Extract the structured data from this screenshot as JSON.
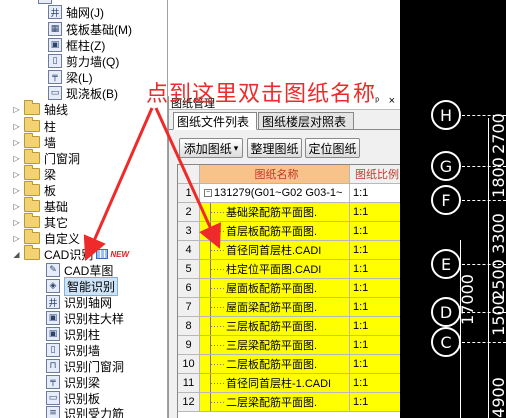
{
  "tree": {
    "items": [
      {
        "label": "轴网(J)",
        "icon": "axis-grid-icon",
        "glyph": "井"
      },
      {
        "label": "筏板基础(M)",
        "icon": "raft-foundation-icon",
        "glyph": "▦"
      },
      {
        "label": "框柱(Z)",
        "icon": "frame-column-icon",
        "glyph": "▣"
      },
      {
        "label": "剪力墙(Q)",
        "icon": "shear-wall-icon",
        "glyph": "▯"
      },
      {
        "label": "梁(L)",
        "icon": "beam-icon",
        "glyph": "╤"
      },
      {
        "label": "现浇板(B)",
        "icon": "slab-icon",
        "glyph": "▭"
      }
    ],
    "folders": [
      "轴线",
      "柱",
      "墙",
      "门窗洞",
      "梁",
      "板",
      "基础",
      "其它",
      "自定义"
    ],
    "cad_group": "CAD识别",
    "new_badge": "NEW",
    "cad_items": [
      {
        "label": "CAD草图",
        "icon": "cad-sketch-icon",
        "glyph": "✎"
      },
      {
        "label": "智能识别",
        "icon": "smart-recognition-icon",
        "glyph": "◈"
      },
      {
        "label": "识别轴网",
        "icon": "recognize-axis-icon",
        "glyph": "井"
      },
      {
        "label": "识别柱大样",
        "icon": "recognize-column-detail-icon",
        "glyph": "▣"
      },
      {
        "label": "识别柱",
        "icon": "recognize-column-icon",
        "glyph": "▣"
      },
      {
        "label": "识别墙",
        "icon": "recognize-wall-icon",
        "glyph": "▯"
      },
      {
        "label": "识别门窗洞",
        "icon": "recognize-door-window-icon",
        "glyph": "⊓"
      },
      {
        "label": "识别梁",
        "icon": "recognize-beam-icon",
        "glyph": "╤"
      },
      {
        "label": "识别板",
        "icon": "recognize-slab-icon",
        "glyph": "▭"
      },
      {
        "label": "识别受力筋",
        "icon": "recognize-rebar-icon",
        "glyph": "≡"
      }
    ]
  },
  "panel": {
    "title": "图纸管理",
    "pin": "ᵖ",
    "close": "×",
    "tabs": [
      "图纸文件列表",
      "图纸楼层对照表"
    ],
    "buttons": {
      "add": "添加图纸",
      "add_arrow": "▾",
      "organize": "整理图纸",
      "locate": "定位图纸"
    },
    "columns": [
      "图纸名称",
      "图纸比例"
    ],
    "rows": [
      {
        "num": "1",
        "name": "131279(G01~G02 G03-1~",
        "ratio": "1:1",
        "group": true
      },
      {
        "num": "2",
        "name": "基础梁配筋平面图.",
        "ratio": "1:1"
      },
      {
        "num": "3",
        "name": "首层板配筋平面图.",
        "ratio": "1:1"
      },
      {
        "num": "4",
        "name": "首径同首层柱.CADI",
        "ratio": "1:1"
      },
      {
        "num": "5",
        "name": "柱定位平面图.CADI",
        "ratio": "1:1"
      },
      {
        "num": "6",
        "name": "屋面板配筋平面图.",
        "ratio": "1:1"
      },
      {
        "num": "7",
        "name": "屋面梁配筋平面图.",
        "ratio": "1:1"
      },
      {
        "num": "8",
        "name": "三层板配筋平面图.",
        "ratio": "1:1"
      },
      {
        "num": "9",
        "name": "三层梁配筋平面图.",
        "ratio": "1:1"
      },
      {
        "num": "10",
        "name": "二层板配筋平面图.",
        "ratio": "1:1"
      },
      {
        "num": "11",
        "name": "首径同首层柱-1.CADI",
        "ratio": "1:1"
      },
      {
        "num": "12",
        "name": "二层梁配筋平面图.",
        "ratio": "1:1"
      }
    ]
  },
  "canvas": {
    "axes": [
      "H",
      "G",
      "F",
      "E",
      "D",
      "C"
    ],
    "dims": [
      "1800",
      "2700",
      "3300",
      "2500",
      "1500",
      "4900",
      "17000"
    ]
  },
  "annotation": {
    "text": "点到这里双击图纸名称",
    "color": "#ee2a2a"
  },
  "colors": {
    "highlight": "#ffff00",
    "header": "#f7c38a",
    "canvas_bg": "#000000"
  }
}
